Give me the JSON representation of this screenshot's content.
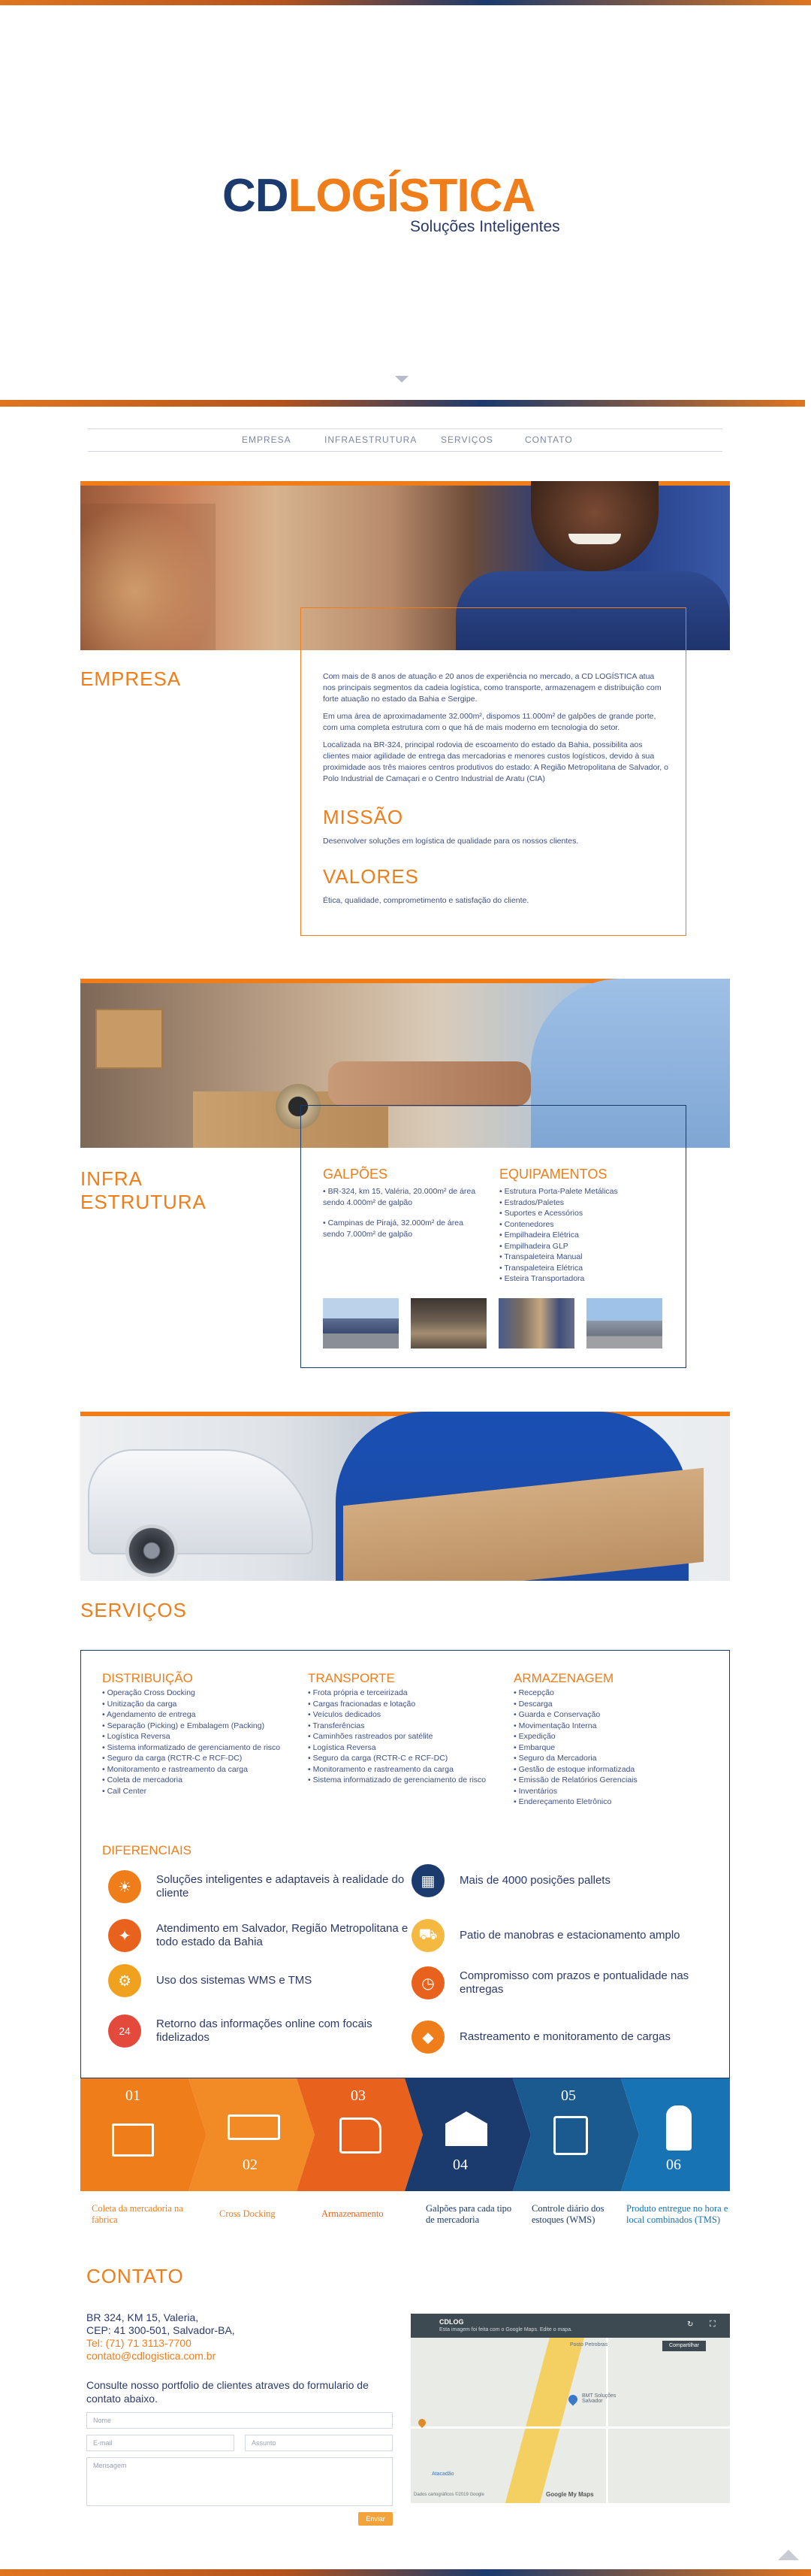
{
  "brand": {
    "logo_cd": "CD",
    "logo_logistica": "LOGÍSTICA",
    "tagline": "Soluções Inteligentes"
  },
  "nav": {
    "items": [
      "EMPRESA",
      "INFRAESTRUTURA",
      "SERVIÇOS",
      "CONTATO"
    ]
  },
  "empresa": {
    "title": "EMPRESA",
    "paragraphs": [
      "Com mais de 8 anos de atuação e 20 anos de experiência no mercado, a CD LOGÍSTICA atua nos principais segmentos da cadeia logística, como transporte, armazenagem e distribuição com forte atuação no estado da Bahia e Sergipe.",
      "Em uma área de aproximadamente 32.000m², dispomos 11.000m² de galpões de grande porte, com uma completa estrutura com o que há de mais moderno em tecnologia do setor.",
      "Localizada na BR-324, principal rodovia de escoamento do estado da Bahia, possibilita aos clientes maior agilidade de entrega das mercadorias e menores custos logísticos, devido à sua proximidade aos três maiores centros produtivos do estado: A Região Metropolitana de Salvador, o Polo Industrial de Camaçari e o Centro Industrial de Aratu (CIA)"
    ],
    "missao_title": "MISSÃO",
    "missao_text": "Desenvolver soluções em logística de qualidade para os nossos clientes.",
    "valores_title": "VALORES",
    "valores_text": "Ética, qualidade, comprometimento e satisfação do cliente."
  },
  "infra": {
    "title_line1": "INFRA",
    "title_line2": "ESTRUTURA",
    "galpoes_title": "GALPÕES",
    "galpoes_items": [
      "• BR-324, km 15, Valéria, 20.000m² de área sendo 4.000m² de galpão",
      "• Campinas de Pirajá, 32.000m² de área sendo 7.000m² de galpão"
    ],
    "equip_title": "EQUIPAMENTOS",
    "equip_items": [
      "• Estrutura Porta-Palete Metálicas",
      "• Estrados/Paletes",
      "• Suportes e Acessórios",
      "• Contenedores",
      "• Empilhadeira Elétrica",
      "• Empilhadeira GLP",
      "• Transpaleteira Manual",
      "• Transpaleteira Elétrica",
      "• Esteira Transportadora"
    ]
  },
  "servicos": {
    "title": "SERVIÇOS",
    "distribuicao_title": "DISTRIBUIÇÃO",
    "distribuicao_items": [
      "• Operação Cross Docking",
      "• Unitização da carga",
      "• Agendamento de entrega",
      "• Separação (Picking) e Embalagem (Packing)",
      "• Logística Reversa",
      "• Sistema informatizado de gerenciamento de risco",
      "• Seguro da carga (RCTR-C e RCF-DC)",
      "• Monitoramento e rastreamento da carga",
      "• Coleta de mercadoria",
      "• Call Center"
    ],
    "transporte_title": "TRANSPORTE",
    "transporte_items": [
      "• Frota própria e terceirizada",
      "• Cargas fracionadas e lotação",
      "• Veículos dedicados",
      "• Transferências",
      "• Caminhões rastreados por satélite",
      "• Logística Reversa",
      "• Seguro da carga (RCTR-C e RCF-DC)",
      "• Monitoramento e rastreamento da carga",
      "• Sistema informatizado de gerenciamento de risco"
    ],
    "armazenagem_title": "ARMAZENAGEM",
    "armazenagem_items": [
      "• Recepção",
      "• Descarga",
      "• Guarda e Conservação",
      "• Movimentação Interna",
      "• Expedição",
      "• Embarque",
      "• Seguro da Mercadoria",
      "• Gestão de estoque informatizada",
      "• Emissão de Relatórios Gerenciais",
      "• Inventários",
      "• Endereçamento Eletrônico"
    ],
    "diferenciais_title": "DIFERENCIAIS",
    "diferenciais": [
      "Soluções inteligentes e adaptaveis à realidade do cliente",
      "Mais de 4000 posições pallets",
      "Atendimento em Salvador, Região Metropolitana e todo estado da Bahia",
      "Patio de manobras e estacionamento amplo",
      "Uso dos sistemas WMS e TMS",
      "Compromisso com prazos e pontualidade nas entregas",
      "Retorno das informações online com focais fidelizados",
      "Rastreamento e monitoramento de cargas"
    ]
  },
  "process": {
    "steps": [
      {
        "num": "01",
        "label": "Coleta da mercadoria na fábrica",
        "color": "#ef7d1a",
        "label_color": "#ef7d1a"
      },
      {
        "num": "02",
        "label": "Cross Docking",
        "color": "#ef7d1a",
        "label_color": "#ef7d1a"
      },
      {
        "num": "03",
        "label": "Armazenamento",
        "color": "#e8621e",
        "label_color": "#e8621e"
      },
      {
        "num": "04",
        "label": "Galpões para cada tipo de mercadoria",
        "color": "#1b3a6d",
        "label_color": "#1b3a6d"
      },
      {
        "num": "05",
        "label": "Controle diário dos estoques (WMS)",
        "color": "#1b5a8e",
        "label_color": "#1b3a6d"
      },
      {
        "num": "06",
        "label": "Produto entregue no hora e local combinados (TMS)",
        "color": "#1773b3",
        "label_color": "#1773b3"
      }
    ]
  },
  "contato": {
    "title": "CONTATO",
    "address_line1": "BR 324, KM 15, Valeria,",
    "address_line2": "CEP: 41 300-501, Salvador-BA,",
    "phone": "Tel: (71) 71 3113-7700",
    "email": "contato@cdlogistica.com.br",
    "form_intro": "Consulte nosso portfolio de clientes atraves do formulario de contato abaixo.",
    "placeholder_name": "Nome",
    "placeholder_email": "E-mail",
    "placeholder_subject": "Assunto",
    "placeholder_message": "Mensagem",
    "send_label": "Enviar"
  },
  "map": {
    "title": "CDLOG",
    "subtitle": "Esta imagem foi feita com o Google Maps. Edite o mapa.",
    "share_label": "Compartilhar",
    "place_label": "BMT Soluções Salvador",
    "poi_1": "Posto Petrobras",
    "poi_2": "Atacadão",
    "footer_text": "Dados cartográficos ©2019 Google",
    "google_label": "Google My Maps"
  },
  "colors": {
    "orange": "#ef7d1a",
    "navy": "#1b3a6d",
    "blue": "#1773b3"
  }
}
